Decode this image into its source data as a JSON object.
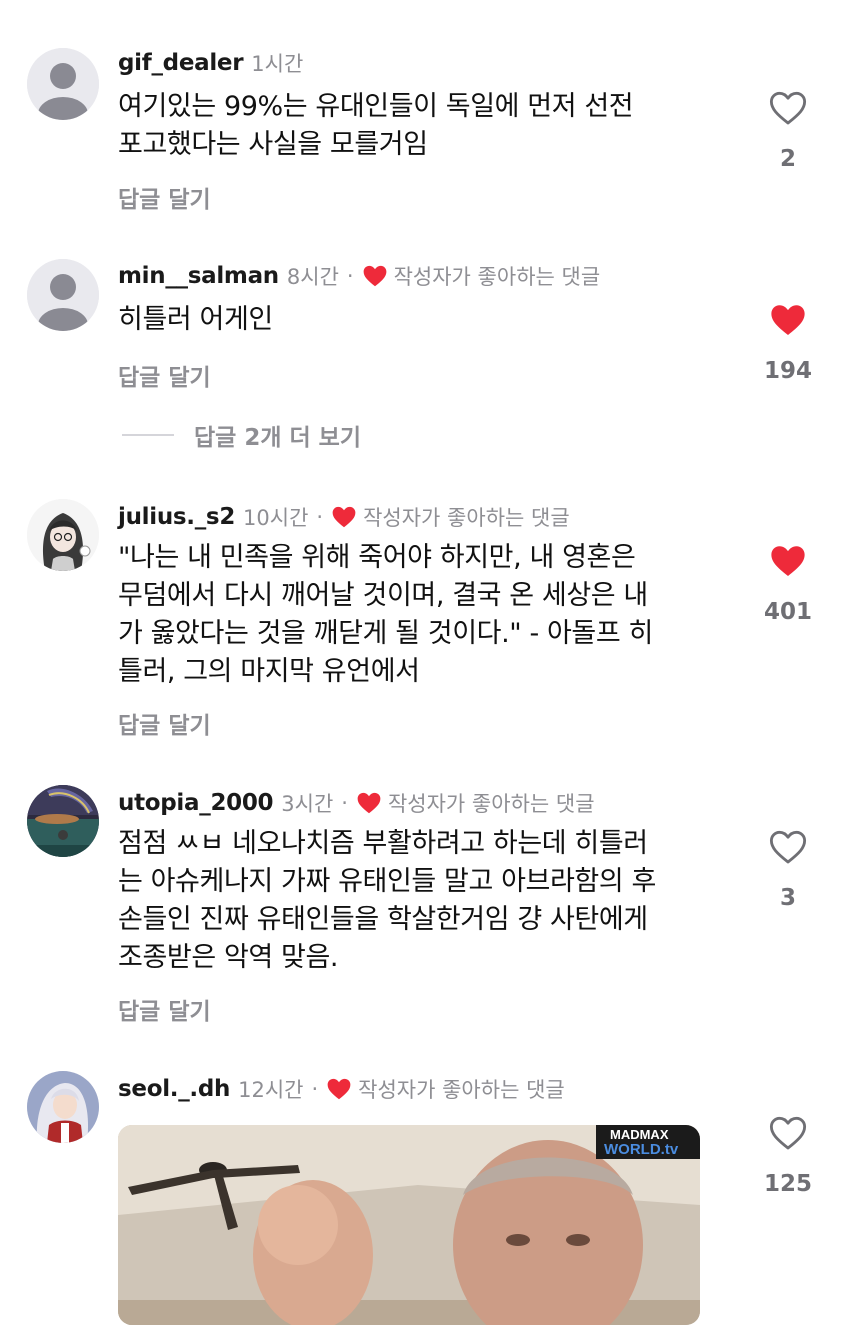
{
  "comments": [
    {
      "username": "gif_dealer",
      "time": "1시간",
      "creator_liked": false,
      "text": "여기있는 99%는 유대인들이 독일에 먼저 선전\n포고했다는 사실을 모를거임",
      "reply_label": "답글 달기",
      "liked": false,
      "likes": "2"
    },
    {
      "username": "min__salman",
      "time": "8시간",
      "creator_liked": true,
      "creator_label": "작성자가 좋아하는 댓글",
      "text": "히틀러 어게인",
      "reply_label": "답글 달기",
      "liked": true,
      "likes": "194",
      "view_replies": "답글 2개 더 보기"
    },
    {
      "username": "julius._s2",
      "time": "10시간",
      "creator_liked": true,
      "creator_label": "작성자가 좋아하는 댓글",
      "text": "\"나는 내 민족을 위해 죽어야 하지만, 내 영혼은\n무덤에서 다시 깨어날 것이며, 결국 온 세상은 내\n가 옳았다는 것을 깨닫게 될 것이다.\" - 아돌프 히\n틀러, 그의 마지막 유언에서",
      "reply_label": "답글 달기",
      "liked": true,
      "likes": "401"
    },
    {
      "username": "utopia_2000",
      "time": "3시간",
      "creator_liked": true,
      "creator_label": "작성자가 좋아하는 댓글",
      "text": "점점 ㅆㅂ 네오나치즘 부활하려고 하는데 히틀러\n는 아슈케나지 가짜 유태인들 말고 아브라함의 후\n손들인 진짜 유태인들을 학살한거임 걍 사탄에게\n조종받은 악역 맞음.",
      "reply_label": "답글 달기",
      "liked": false,
      "likes": "3"
    },
    {
      "username": "seol._.dh",
      "time": "12시간",
      "creator_liked": true,
      "creator_label": "작성자가 좋아하는 댓글",
      "liked": false,
      "likes": "125",
      "media_watermark": [
        "MADMAX",
        "WORLD.tv"
      ]
    }
  ],
  "colors": {
    "heart_red": "#ee2a3a",
    "secondary_text": "#8e8e93",
    "primary_text": "#111111"
  },
  "icons": {
    "like": "heart-icon",
    "creator_like": "heart-icon"
  }
}
